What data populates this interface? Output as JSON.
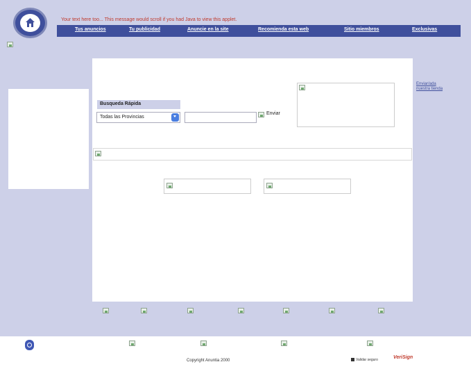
{
  "marquee_text": "Your text here too... This message would scroll if you had Java to view this applet.",
  "nav": {
    "items": [
      {
        "label": "Tus anuncios"
      },
      {
        "label": "Tu publicidad"
      },
      {
        "label": "Anuncie en la site"
      },
      {
        "label": "Recomienda esta web"
      },
      {
        "label": "Sitio miembros"
      },
      {
        "label": "Exclusivas"
      }
    ]
  },
  "search": {
    "title": "Busqueda Rápida",
    "province_selected": "Todas las Provincias",
    "submit_label": "Enviar"
  },
  "right_link": {
    "line1": "Enviar/ada",
    "line2": "nuestra tienda"
  },
  "footer": {
    "copyright": "Copyright Anuntia 2000",
    "validate": "Validar seguro",
    "verisign": "VeriSign"
  },
  "colors": {
    "background": "#cdd0e8",
    "nav_bar": "#3f4f9c",
    "marquee": "#c0392b"
  }
}
